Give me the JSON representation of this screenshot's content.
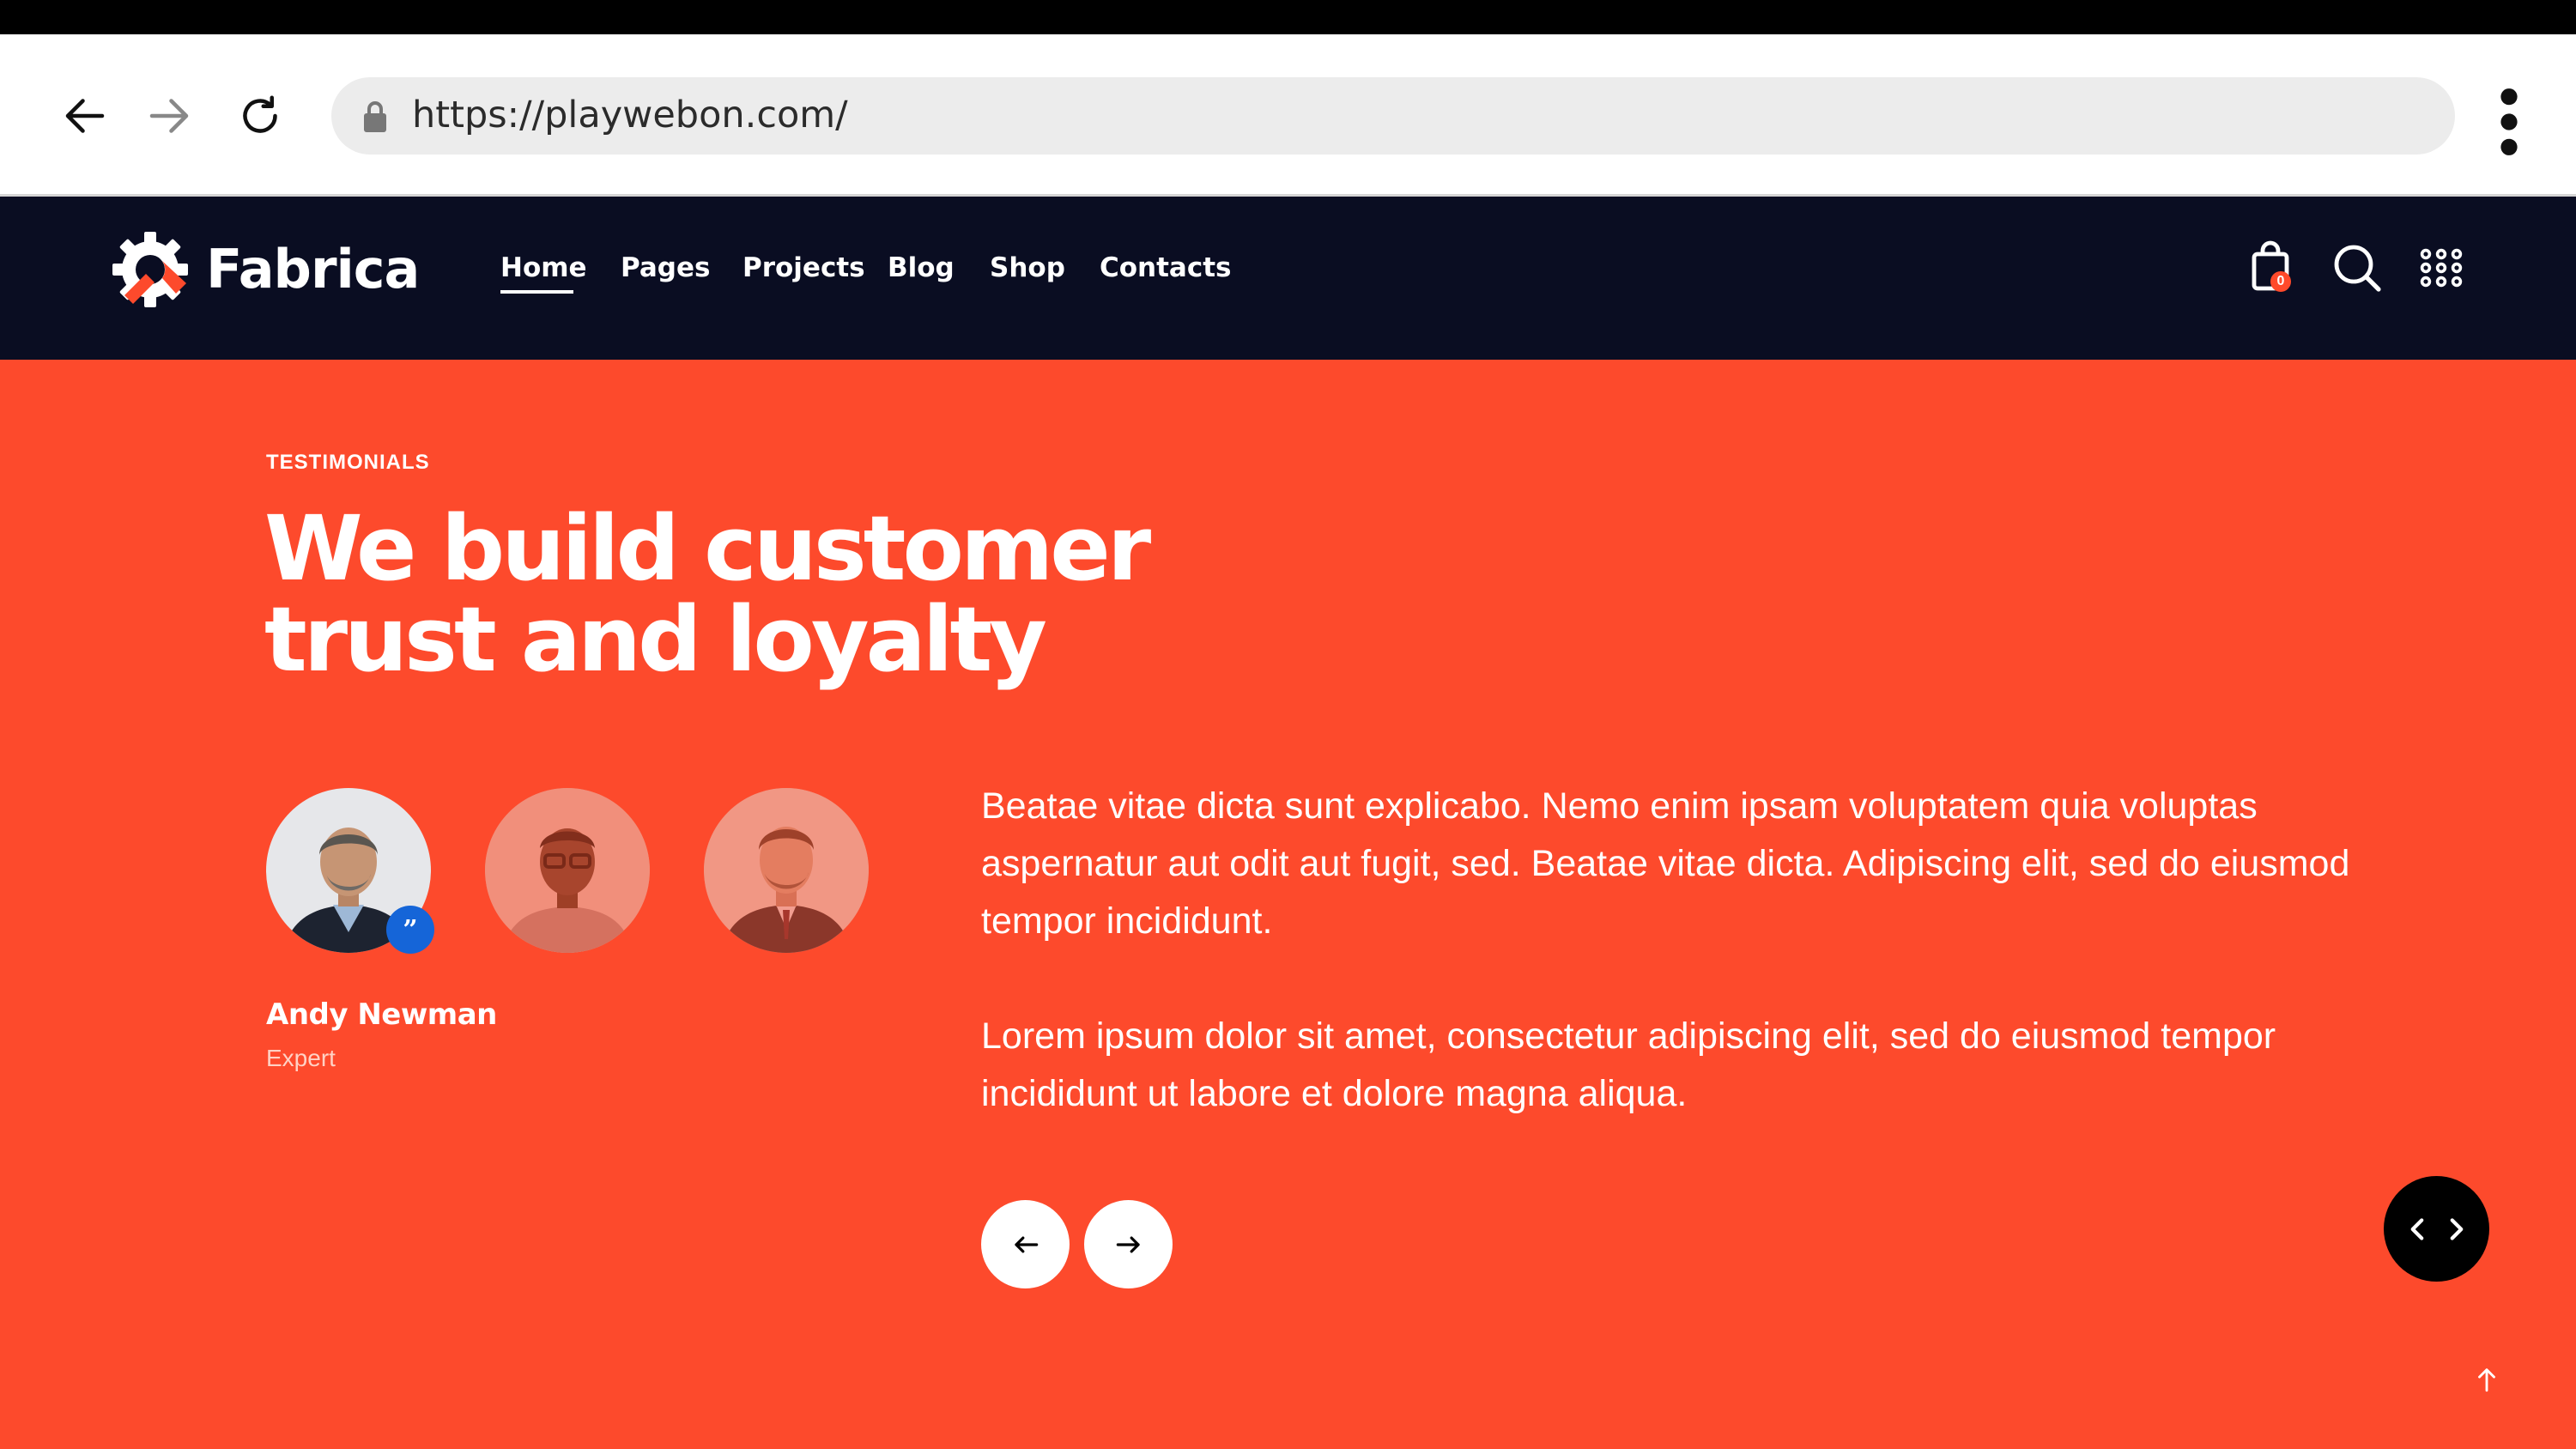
{
  "browser": {
    "url": "https://playwebon.com/",
    "icons": [
      "back-arrow-icon",
      "forward-arrow-icon",
      "reload-icon",
      "lock-icon",
      "more-vert-icon"
    ]
  },
  "header": {
    "logo_text": "Fabrica",
    "menu": [
      "Home",
      "Pages",
      "Projects",
      "Blog",
      "Shop",
      "Contacts"
    ],
    "active_menu": "Home",
    "cart_count": "0",
    "icons": [
      "cart-icon",
      "search-icon",
      "grid-menu-icon"
    ]
  },
  "testimonials": {
    "eyebrow": "TESTIMONIALS",
    "headline": "We build customer\ntrust and loyalty",
    "active_person": {
      "name": "Andy Newman",
      "role": "Expert"
    },
    "quote_paragraphs": [
      "Beatae vitae dicta sunt explicabo. Nemo enim ipsam voluptatem quia voluptas aspernatur aut odit aut fugit, sed. Beatae vitae dicta. Adipiscing elit, sed do eiusmod tempor incididunt.",
      "Lorem ipsum dolor sit amet, consectetur adipiscing elit, sed do eiusmod tempor incididunt ut labore et dolore magna aliqua."
    ]
  },
  "colors": {
    "accent": "#fd4a2c",
    "header_bg": "#0a0d22",
    "quote_badge": "#1565d8"
  }
}
